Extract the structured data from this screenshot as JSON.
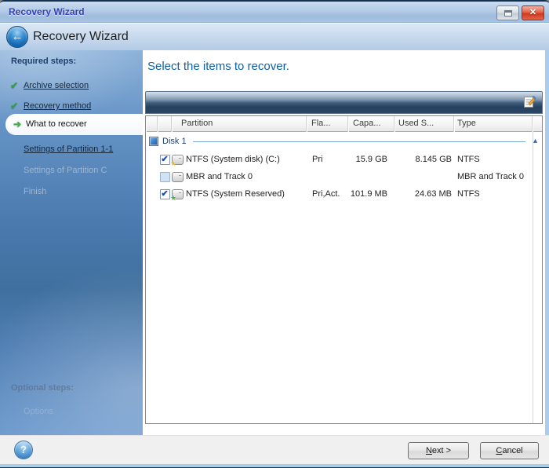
{
  "window": {
    "title": "Recovery Wizard"
  },
  "header": {
    "title": "Recovery Wizard"
  },
  "icons": {
    "back": "←",
    "close": "✕",
    "help": "?",
    "check": "✔",
    "current_arrow": "➔",
    "collapse": "▴",
    "star": "★"
  },
  "sidebar": {
    "required_label": "Required steps:",
    "optional_label": "Optional steps:",
    "steps": [
      {
        "label": "Archive selection",
        "state": "done",
        "icon": "✔"
      },
      {
        "label": "Recovery method",
        "state": "done",
        "icon": "✔"
      },
      {
        "label": "What to recover",
        "state": "current",
        "icon": "➔"
      },
      {
        "label": "Settings of Partition 1-1",
        "state": "upcoming",
        "icon": ""
      },
      {
        "label": "Settings of Partition C",
        "state": "disabled",
        "icon": ""
      },
      {
        "label": "Finish",
        "state": "disabled",
        "icon": ""
      }
    ],
    "optional_steps": [
      {
        "label": "Options",
        "state": "disabled",
        "icon": ""
      }
    ]
  },
  "main": {
    "heading": "Select the items to recover.",
    "table": {
      "columns": {
        "partition": "Partition",
        "flags": "Fla...",
        "capacity": "Capa...",
        "used": "Used S...",
        "type": "Type"
      },
      "group": {
        "label": "Disk 1"
      },
      "rows": [
        {
          "checkbox": "true",
          "star": "yellow",
          "partition": "NTFS (System disk) (C:)",
          "flags": "Pri",
          "capacity": "15.9 GB",
          "used": "8.145 GB",
          "type": "NTFS"
        },
        {
          "checkbox": "false",
          "star": "none",
          "partition": "MBR and Track 0",
          "flags": "",
          "capacity": "",
          "used": "",
          "type": "MBR and Track 0"
        },
        {
          "checkbox": "true",
          "star": "green",
          "partition": "NTFS (System Reserved)",
          "flags": "Pri,Act.",
          "capacity": "101.9 MB",
          "used": "24.63 MB",
          "type": "NTFS"
        }
      ]
    }
  },
  "footer": {
    "next_key": "N",
    "next_rest": "ext >",
    "cancel_key": "C",
    "cancel_rest": "ancel"
  },
  "colors": {
    "heading_blue": "#0e61ae",
    "titlebar_text": "#3340bb",
    "sidebar_top": "#8ab0d9",
    "sidebar_bottom": "#6b99cd",
    "toolbar_dark": "#24415f",
    "close_red": "#cf3a1e",
    "check_green": "#2fa33c",
    "footer_gray": "#f0f0f0",
    "strip_light_blue": "#a9cdea",
    "strip_dark_teal": "#143f4e"
  }
}
